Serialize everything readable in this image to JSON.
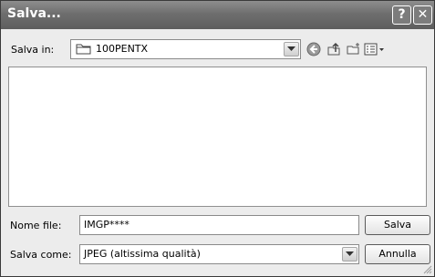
{
  "window": {
    "title": "Salva..."
  },
  "titlebar_buttons": {
    "help": "?",
    "close": "✕"
  },
  "toolbar": {
    "save_in_label": "Salva in:",
    "folder": "100PENTX",
    "icons": [
      "back-icon",
      "up-folder-icon",
      "new-folder-icon",
      "view-menu-icon"
    ]
  },
  "form": {
    "filename_label": "Nome file:",
    "filename_value": "IMGP****",
    "savetype_label": "Salva come:",
    "savetype_value": "JPEG (altissima qualità)"
  },
  "buttons": {
    "save": "Salva",
    "cancel": "Annulla"
  }
}
